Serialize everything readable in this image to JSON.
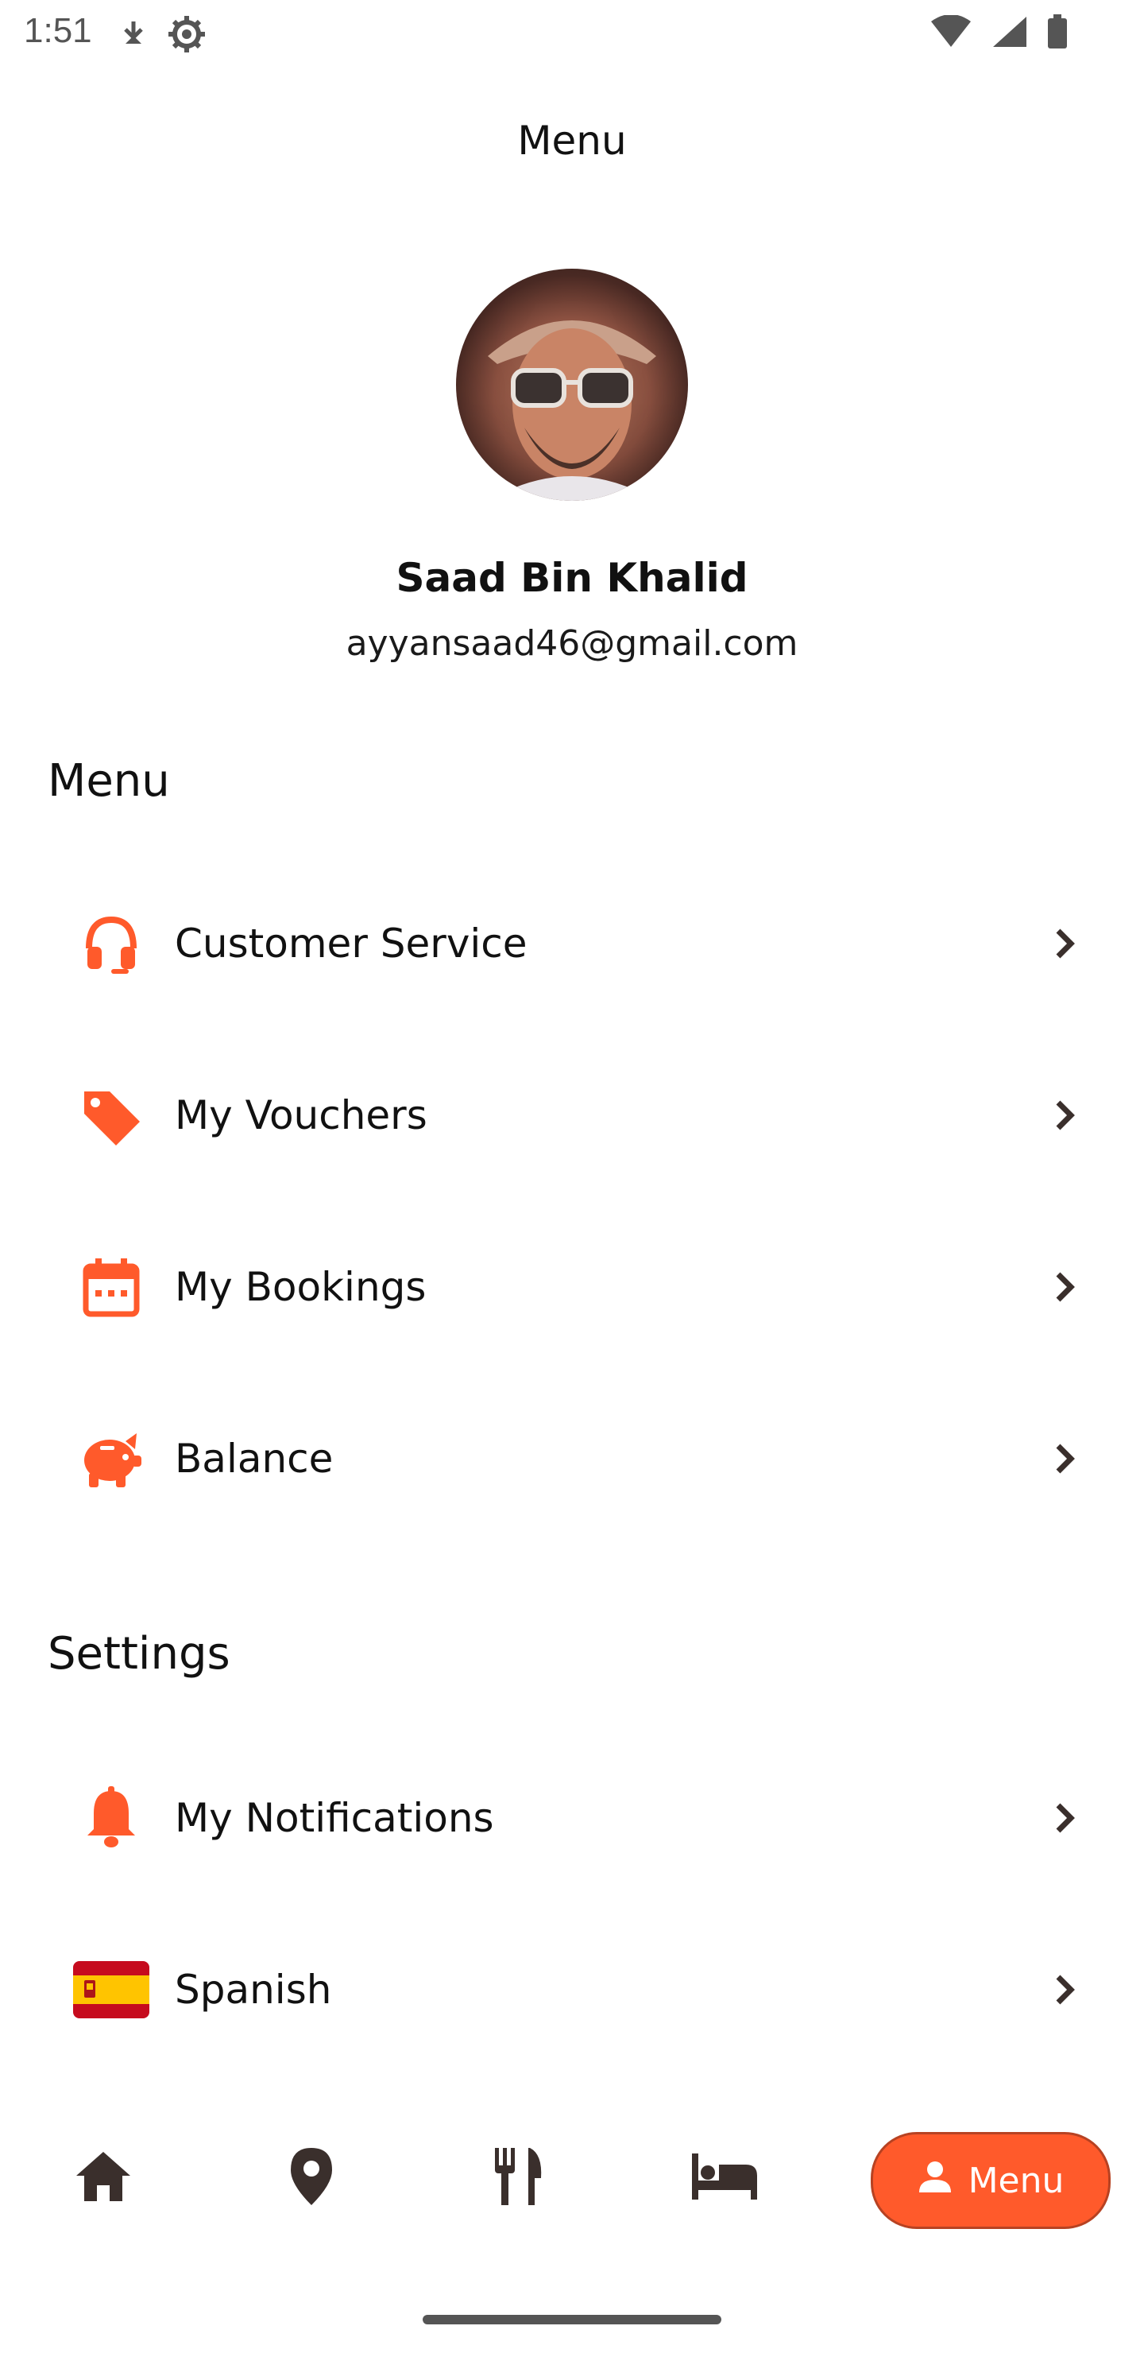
{
  "status_bar": {
    "time": "1:51",
    "icons_left": [
      "download-indicator-icon",
      "settings-gear-icon"
    ],
    "icons_right": [
      "wifi-icon",
      "signal-icon",
      "battery-icon"
    ]
  },
  "header": {
    "title": "Menu"
  },
  "profile": {
    "name": "Saad Bin Khalid",
    "email": "ayyansaad46@gmail.com"
  },
  "sections": {
    "menu": {
      "title": "Menu",
      "items": [
        {
          "label": "Customer Service",
          "icon": "headset-icon"
        },
        {
          "label": "My Vouchers",
          "icon": "tag-icon"
        },
        {
          "label": "My Bookings",
          "icon": "calendar-icon"
        },
        {
          "label": "Balance",
          "icon": "piggy-bank-icon"
        }
      ]
    },
    "settings": {
      "title": "Settings",
      "items": [
        {
          "label": "My Notifications",
          "icon": "bell-icon"
        },
        {
          "label": "Spanish",
          "icon": "spain-flag-icon"
        }
      ]
    }
  },
  "bottom_nav": {
    "items": [
      {
        "name": "home",
        "icon": "home-icon"
      },
      {
        "name": "location",
        "icon": "location-pin-icon"
      },
      {
        "name": "restaurants",
        "icon": "fork-knife-icon"
      },
      {
        "name": "hotels",
        "icon": "bed-icon"
      }
    ],
    "active": {
      "label": "Menu",
      "icon": "person-icon"
    }
  },
  "colors": {
    "accent": "#ff5a2b",
    "text": "#111111",
    "chevron": "#3a2f2c"
  }
}
